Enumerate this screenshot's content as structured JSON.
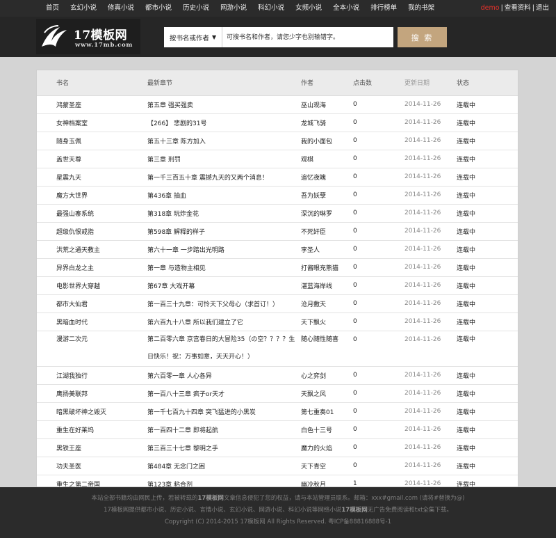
{
  "nav": {
    "links": [
      "首页",
      "玄幻小说",
      "修真小说",
      "都市小说",
      "历史小说",
      "网游小说",
      "科幻小说",
      "女频小说",
      "全本小说",
      "排行榜单",
      "我的书架"
    ],
    "username": "demo",
    "profile_link": "查看资料",
    "logout_link": "退出"
  },
  "logo": {
    "title": "17模板网",
    "url": "www.17mb.com"
  },
  "search": {
    "select_label": "按书名或作者",
    "placeholder": "可搜书名和作者，请您少字也别输错字。",
    "button": "搜 索"
  },
  "table": {
    "headers": {
      "name": "书名",
      "chapter": "最新章节",
      "author": "作者",
      "clicks": "点击数",
      "date": "更新日期",
      "status": "状态"
    },
    "rows": [
      {
        "name": "鸿蒙圣座",
        "chapter": "第五章 强买强卖",
        "author": "巫山观海",
        "clicks": "0",
        "date": "2014-11-26",
        "status": "连载中"
      },
      {
        "name": "女神档案室",
        "chapter": "【266】 悲剧的31号",
        "author": "龙城飞骑",
        "clicks": "0",
        "date": "2014-11-26",
        "status": "连载中"
      },
      {
        "name": "随身玉佩",
        "chapter": "第五十三章 陈方加入",
        "author": "我的小面包",
        "clicks": "0",
        "date": "2014-11-26",
        "status": "连载中"
      },
      {
        "name": "盖世天尊",
        "chapter": "第三章 刑罚",
        "author": "观棋",
        "clicks": "0",
        "date": "2014-11-26",
        "status": "连载中"
      },
      {
        "name": "星震九天",
        "chapter": "第一千三百五十章 震撼九天的又两个消息！",
        "author": "追忆夜魄",
        "clicks": "0",
        "date": "2014-11-26",
        "status": "连载中"
      },
      {
        "name": "魔方大世界",
        "chapter": "第436章 抽血",
        "author": "吾为妖孽",
        "clicks": "0",
        "date": "2014-11-26",
        "status": "连载中"
      },
      {
        "name": "最强山寨系统",
        "chapter": "第318章 玩炸金花",
        "author": "深沉的琳罗",
        "clicks": "0",
        "date": "2014-11-26",
        "status": "连载中"
      },
      {
        "name": "超级仇恨戒指",
        "chapter": "第598章 解释的样子",
        "author": "不死奸臣",
        "clicks": "0",
        "date": "2014-11-26",
        "status": "连载中"
      },
      {
        "name": "洪荒之通天教主",
        "chapter": "第六十一章 一步踏出光明路",
        "author": "李圣人",
        "clicks": "0",
        "date": "2014-11-26",
        "status": "连载中"
      },
      {
        "name": "异界白龙之主",
        "chapter": "第一章 与造物主相见",
        "author": "打酱眼充熊猫",
        "clicks": "0",
        "date": "2014-11-26",
        "status": "连载中"
      },
      {
        "name": "电影世界大穿越",
        "chapter": "第67章 大戏开幕",
        "author": "湛蓝海岸线",
        "clicks": "0",
        "date": "2014-11-26",
        "status": "连载中"
      },
      {
        "name": "都市大仙君",
        "chapter": "第一百三十九章：可怜天下父母心（求首订！）",
        "author": "沧月敷天",
        "clicks": "0",
        "date": "2014-11-26",
        "status": "连载中"
      },
      {
        "name": "黑暗血时代",
        "chapter": "第六百九十八章 所以我们建立了它",
        "author": "天下飘火",
        "clicks": "0",
        "date": "2014-11-26",
        "status": "连载中"
      },
      {
        "name": "漫游二次元",
        "chapter": "第二百零六章 京宫春日的大冒险35（の空？？？？生日快乐！祝：万事如意，天天开心！）",
        "author": "随心随性随喜",
        "clicks": "0",
        "date": "2014-11-26",
        "status": "连载中",
        "tall": true
      },
      {
        "name": "江湖我独行",
        "chapter": "第六百零一章 人心各异",
        "author": "心之弈剑",
        "clicks": "0",
        "date": "2014-11-26",
        "status": "连载中"
      },
      {
        "name": "鹰扬美联邦",
        "chapter": "第一百八十三章 疯子or天才",
        "author": "天飘之风",
        "clicks": "0",
        "date": "2014-11-26",
        "status": "连载中"
      },
      {
        "name": "暗黑破坏神之毁灭",
        "chapter": "第一千七百九十四章 突飞猛进的小黑炭",
        "author": "第七重奏01",
        "clicks": "0",
        "date": "2014-11-26",
        "status": "连载中"
      },
      {
        "name": "重生在好莱坞",
        "chapter": "第一百四十二章 即将起航",
        "author": "白色十三号",
        "clicks": "0",
        "date": "2014-11-26",
        "status": "连载中"
      },
      {
        "name": "黑铁王座",
        "chapter": "第三百三十七章 黎明之手",
        "author": "魔力的火焰",
        "clicks": "0",
        "date": "2014-11-26",
        "status": "连载中"
      },
      {
        "name": "功夫圣医",
        "chapter": "第484章 无念门之困",
        "author": "天下青空",
        "clicks": "0",
        "date": "2014-11-26",
        "status": "连载中"
      },
      {
        "name": "重生之第二帝国",
        "chapter": "第123章 粘合剂",
        "author": "幽冷秋月",
        "clicks": "1",
        "date": "2014-11-26",
        "status": "连载中"
      }
    ]
  },
  "footer": {
    "line1_pre": "本站全部书籍均由网民上传，若被转载的",
    "line1_brand": "17模板网",
    "line1_post": "文章信息侵犯了您的权益，请与本站管理员联系。邮箱：xxx#gmail.com (请将#替换为@)",
    "line2_pre": "17模板网提供都市小说、历史小说、言情小说、玄幻小说、网游小说、科幻小说等网络小说",
    "line2_brand": "17模板网",
    "line2_post": "无广告免费阅读和txt全集下载。",
    "line3": "Copyright (C) 2014-2015 17模板网 All Rights Reserved. 粤ICP备88816888号-1"
  }
}
